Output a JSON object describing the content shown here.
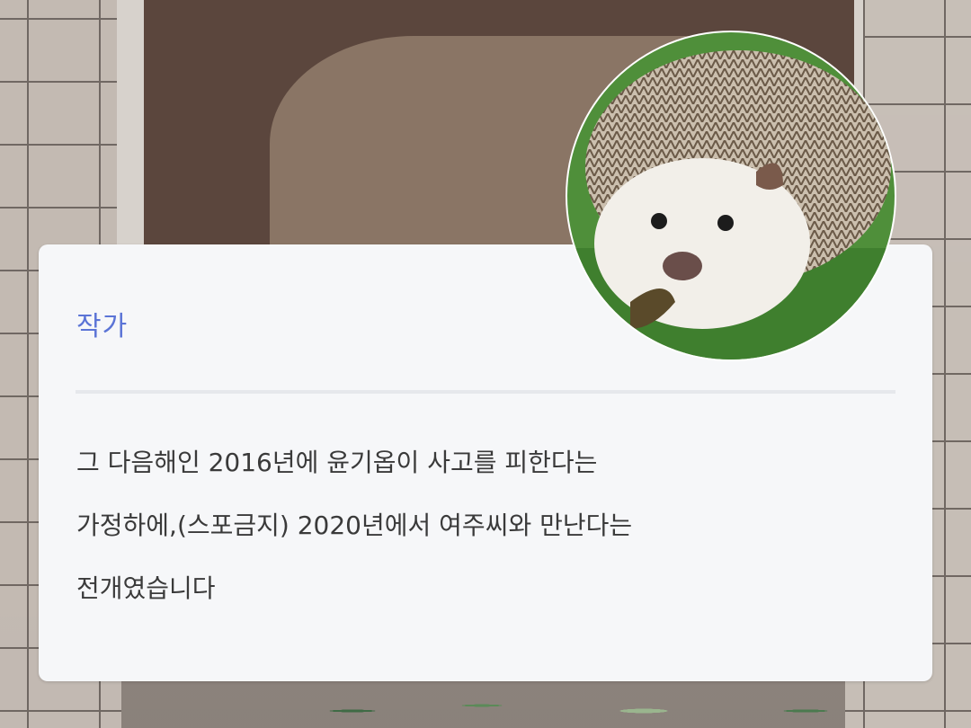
{
  "card": {
    "label": "작가",
    "body_lines": [
      "그 다음해인 2016년에 윤기옵이 사고를 피한다는",
      "가정하에,(스포금지) 2020년에서 여주씨와 만난다는",
      "전개였습니다"
    ]
  },
  "avatar": {
    "icon": "hedgehog-photo",
    "ring_color": "#ffffff"
  },
  "colors": {
    "label": "#5b74d6",
    "body_text": "#3a3a3a",
    "card_bg": "#f6f7f9",
    "divider": "#e6e8ec"
  }
}
